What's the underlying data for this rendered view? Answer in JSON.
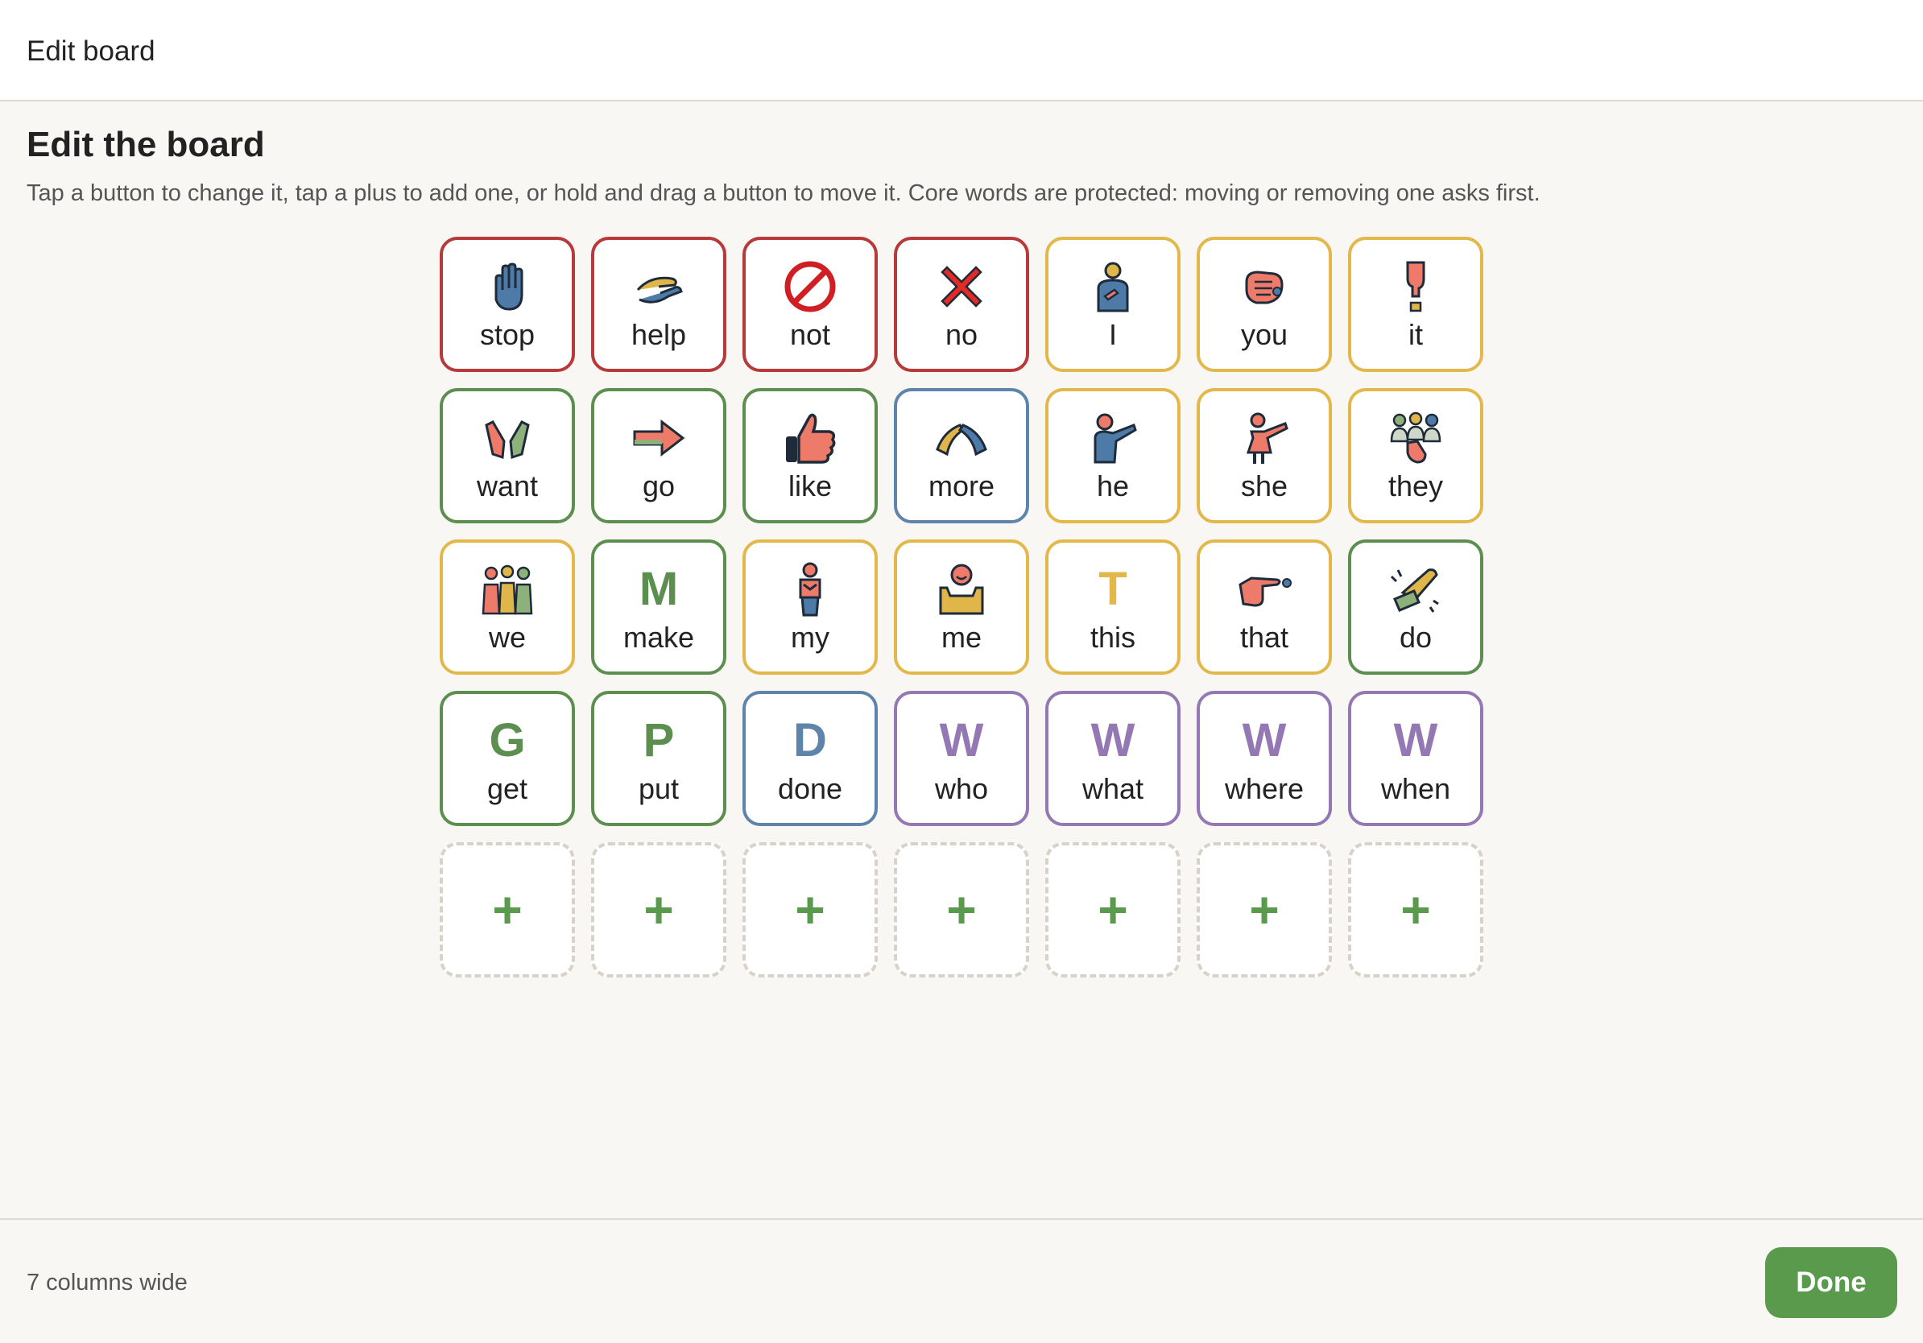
{
  "topbar": {
    "title": "Edit board"
  },
  "main": {
    "heading": "Edit the board",
    "instructions": "Tap a button to change it, tap a plus to add one, or hold and drag a button to move it. Core words are protected: moving or removing one asks first."
  },
  "colors": {
    "red": "#b8393a",
    "yellow": "#e2b84a",
    "green": "#5c8f4f",
    "blue": "#5f84ab",
    "purple": "#9478b4",
    "accent": "#5a9a4c"
  },
  "board": {
    "tiles": [
      {
        "word": "stop",
        "color": "red",
        "icon": "raised-hand-icon"
      },
      {
        "word": "help",
        "color": "red",
        "icon": "helping-hands-icon"
      },
      {
        "word": "not",
        "color": "red",
        "icon": "prohibited-icon"
      },
      {
        "word": "no",
        "color": "red",
        "icon": "red-x-icon"
      },
      {
        "word": "I",
        "color": "yellow",
        "icon": "person-pointing-self-icon"
      },
      {
        "word": "you",
        "color": "yellow",
        "icon": "fist-pointing-icon"
      },
      {
        "word": "it",
        "color": "yellow",
        "icon": "finger-pointing-down-icon"
      },
      {
        "word": "want",
        "color": "green",
        "icon": "reaching-hands-icon"
      },
      {
        "word": "go",
        "color": "green",
        "icon": "right-arrow-icon"
      },
      {
        "word": "like",
        "color": "green",
        "icon": "thumbs-up-icon"
      },
      {
        "word": "more",
        "color": "blue",
        "icon": "hands-together-icon"
      },
      {
        "word": "he",
        "color": "yellow",
        "icon": "boy-pointing-icon"
      },
      {
        "word": "she",
        "color": "yellow",
        "icon": "girl-pointing-icon"
      },
      {
        "word": "they",
        "color": "yellow",
        "icon": "group-pointing-icon"
      },
      {
        "word": "we",
        "color": "yellow",
        "icon": "three-people-icon"
      },
      {
        "word": "make",
        "color": "green",
        "letter": "M"
      },
      {
        "word": "my",
        "color": "yellow",
        "icon": "person-hands-chest-icon"
      },
      {
        "word": "me",
        "color": "yellow",
        "icon": "smiling-person-icon"
      },
      {
        "word": "this",
        "color": "yellow",
        "letter": "T"
      },
      {
        "word": "that",
        "color": "yellow",
        "icon": "hand-pointing-right-icon"
      },
      {
        "word": "do",
        "color": "green",
        "icon": "hand-doing-icon"
      },
      {
        "word": "get",
        "color": "green",
        "letter": "G"
      },
      {
        "word": "put",
        "color": "green",
        "letter": "P"
      },
      {
        "word": "done",
        "color": "blue",
        "letter": "D"
      },
      {
        "word": "who",
        "color": "purple",
        "letter": "W"
      },
      {
        "word": "what",
        "color": "purple",
        "letter": "W"
      },
      {
        "word": "where",
        "color": "purple",
        "letter": "W"
      },
      {
        "word": "when",
        "color": "purple",
        "letter": "W"
      }
    ],
    "add_slots": [
      "+",
      "+",
      "+",
      "+",
      "+",
      "+",
      "+"
    ]
  },
  "footer": {
    "columns_info": "7 columns wide",
    "done_label": "Done"
  }
}
